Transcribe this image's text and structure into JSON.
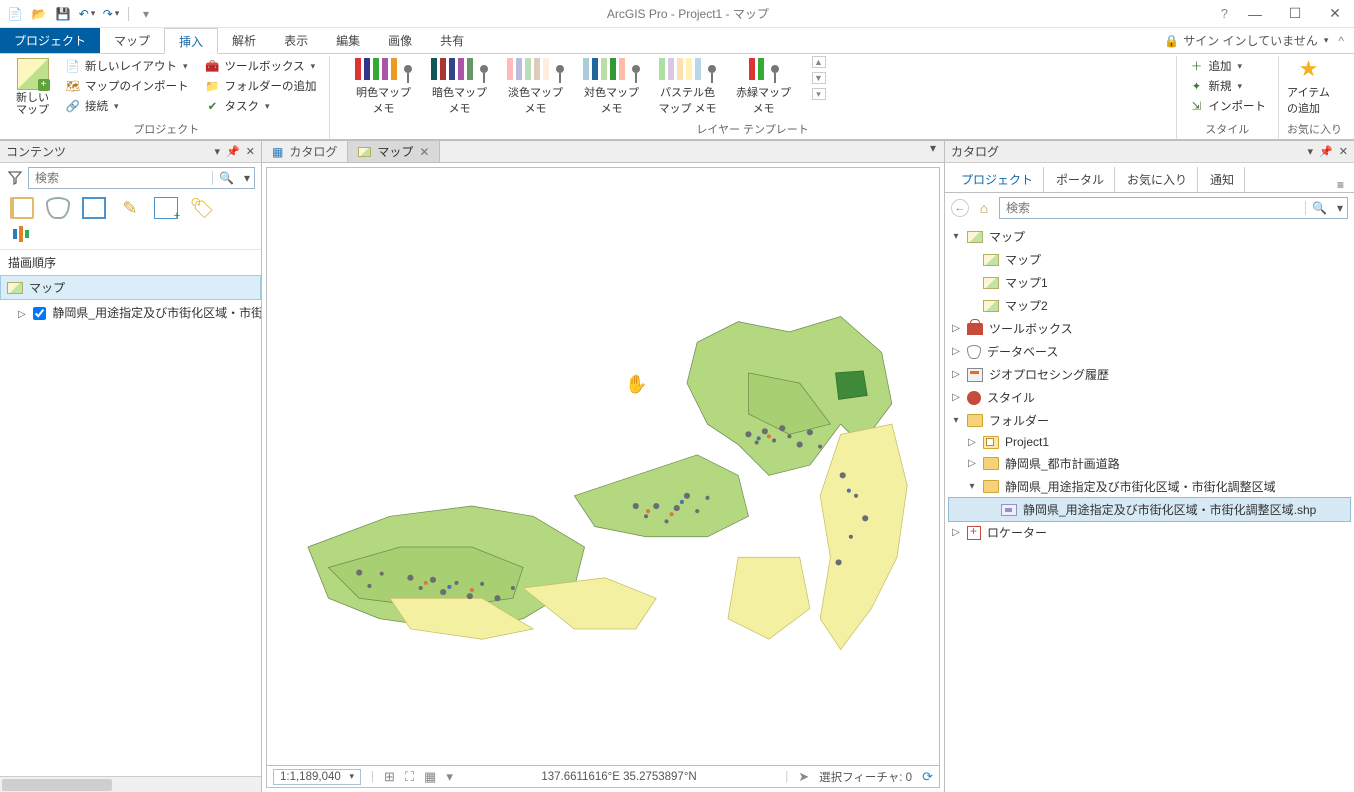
{
  "app": {
    "title": "ArcGIS Pro - Project1 - マップ"
  },
  "signin": {
    "label": "サイン インしていません"
  },
  "tabs": {
    "project": "プロジェクト",
    "map": "マップ",
    "insert": "挿入",
    "analysis": "解析",
    "view": "表示",
    "edit": "編集",
    "image": "画像",
    "share": "共有"
  },
  "ribbon": {
    "newmap_label": "新しい\nマップ",
    "newlayout": "新しいレイアウト",
    "import_map": "マップのインポート",
    "connect": "接続",
    "toolbox": "ツールボックス",
    "add_folder": "フォルダーの追加",
    "task": "タスク",
    "group_project": "プロジェクト",
    "memo_light": "明色マップ\nメモ",
    "memo_dark": "暗色マップ\nメモ",
    "memo_pale": "淡色マップ\nメモ",
    "memo_paired": "対色マップ\nメモ",
    "memo_pastel": "パステル色\nマップ メモ",
    "memo_rg": "赤緑マップ\nメモ",
    "group_template": "レイヤー テンプレート",
    "add": "追加",
    "new": "新規",
    "import": "インポート",
    "group_style": "スタイル",
    "fav_item": "アイテム\nの追加",
    "group_fav": "お気に入り"
  },
  "contents": {
    "title": "コンテンツ",
    "search_ph": "検索",
    "draw_order": "描画順序",
    "map_label": "マップ",
    "layer1": "静岡県_用途指定及び市街化区域・市街化"
  },
  "doc": {
    "tab_catalog": "カタログ",
    "tab_map": "マップ"
  },
  "status": {
    "scale": "1:1,189,040",
    "coord": "137.6611616°E 35.2753897°N",
    "selection": "選択フィーチャ: 0"
  },
  "catalog": {
    "title": "カタログ",
    "tab_project": "プロジェクト",
    "tab_portal": "ポータル",
    "tab_fav": "お気に入り",
    "tab_notify": "通知",
    "search_ph": "検索",
    "node_maps": "マップ",
    "map0": "マップ",
    "map1": "マップ1",
    "map2": "マップ2",
    "node_toolbox": "ツールボックス",
    "node_db": "データベース",
    "node_gp": "ジオプロセシング履歴",
    "node_style": "スタイル",
    "node_folder": "フォルダー",
    "folder_p1": "Project1",
    "folder_road": "静岡県_都市計画道路",
    "folder_zone": "静岡県_用途指定及び市街化区域・市街化調整区域",
    "shp": "静岡県_用途指定及び市街化区域・市街化調整区域.shp",
    "node_locator": "ロケーター"
  }
}
